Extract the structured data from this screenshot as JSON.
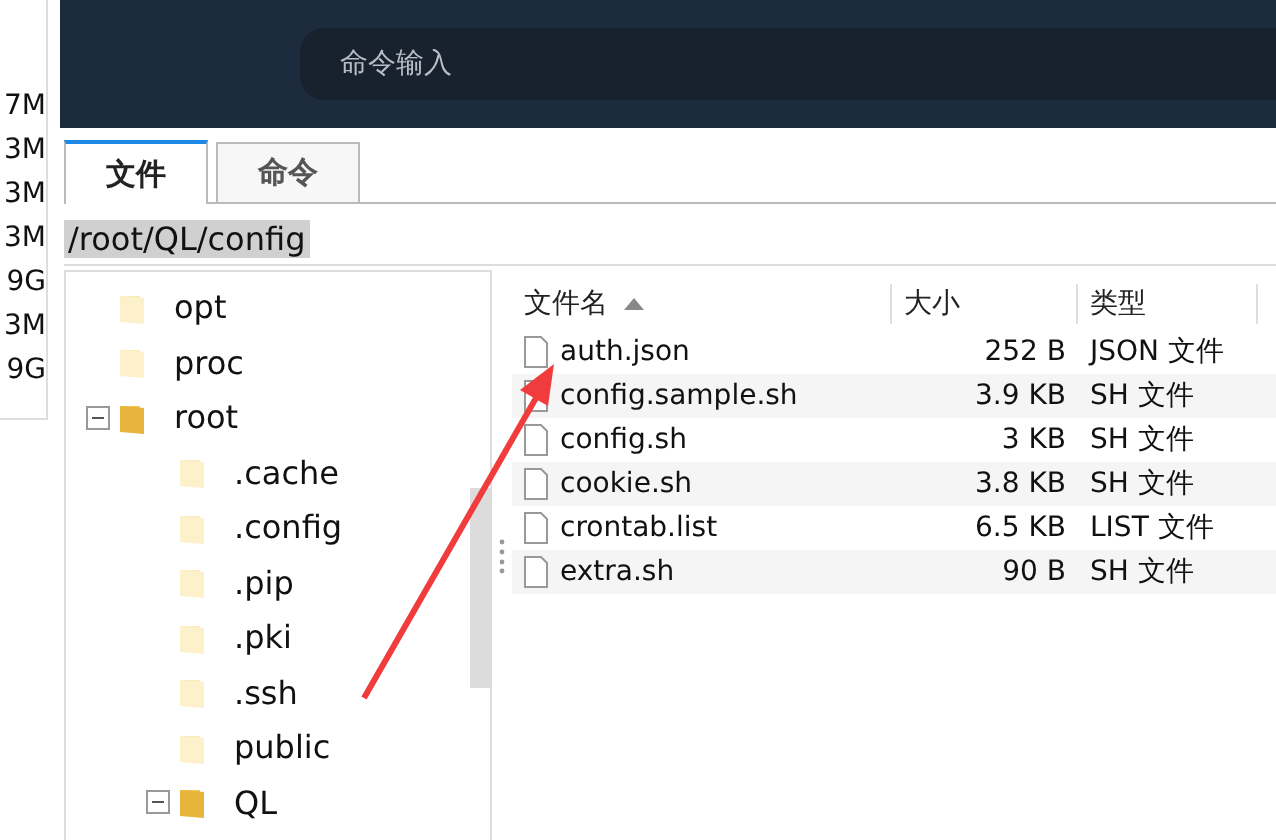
{
  "side_values": [
    "7M",
    "3M",
    "3M",
    "3M",
    "9G",
    "3M",
    "9G"
  ],
  "command_input": {
    "placeholder": "命令输入"
  },
  "tabs": [
    {
      "label": "文件",
      "selected": true
    },
    {
      "label": "命令",
      "selected": false
    }
  ],
  "path_field": {
    "value": "/root/QL/config"
  },
  "tree": [
    {
      "name": "opt"
    },
    {
      "name": "proc"
    },
    {
      "name": "root",
      "expanded": true,
      "children": [
        {
          "name": ".cache"
        },
        {
          "name": ".config"
        },
        {
          "name": ".pip"
        },
        {
          "name": ".pki"
        },
        {
          "name": ".ssh"
        },
        {
          "name": "public"
        },
        {
          "name": "QL",
          "expanded": true
        }
      ]
    }
  ],
  "file_table": {
    "columns": [
      {
        "label": "文件名",
        "sorted": true
      },
      {
        "label": "大小",
        "sorted": false
      },
      {
        "label": "类型",
        "sorted": false
      }
    ],
    "rows": [
      {
        "name": "auth.json",
        "size": "252 B",
        "type": "JSON 文件"
      },
      {
        "name": "config.sample.sh",
        "size": "3.9 KB",
        "type": "SH 文件"
      },
      {
        "name": "config.sh",
        "size": "3 KB",
        "type": "SH 文件"
      },
      {
        "name": "cookie.sh",
        "size": "3.8 KB",
        "type": "SH 文件"
      },
      {
        "name": "crontab.list",
        "size": "6.5 KB",
        "type": "LIST 文件"
      },
      {
        "name": "extra.sh",
        "size": "90 B",
        "type": "SH 文件"
      }
    ]
  }
}
